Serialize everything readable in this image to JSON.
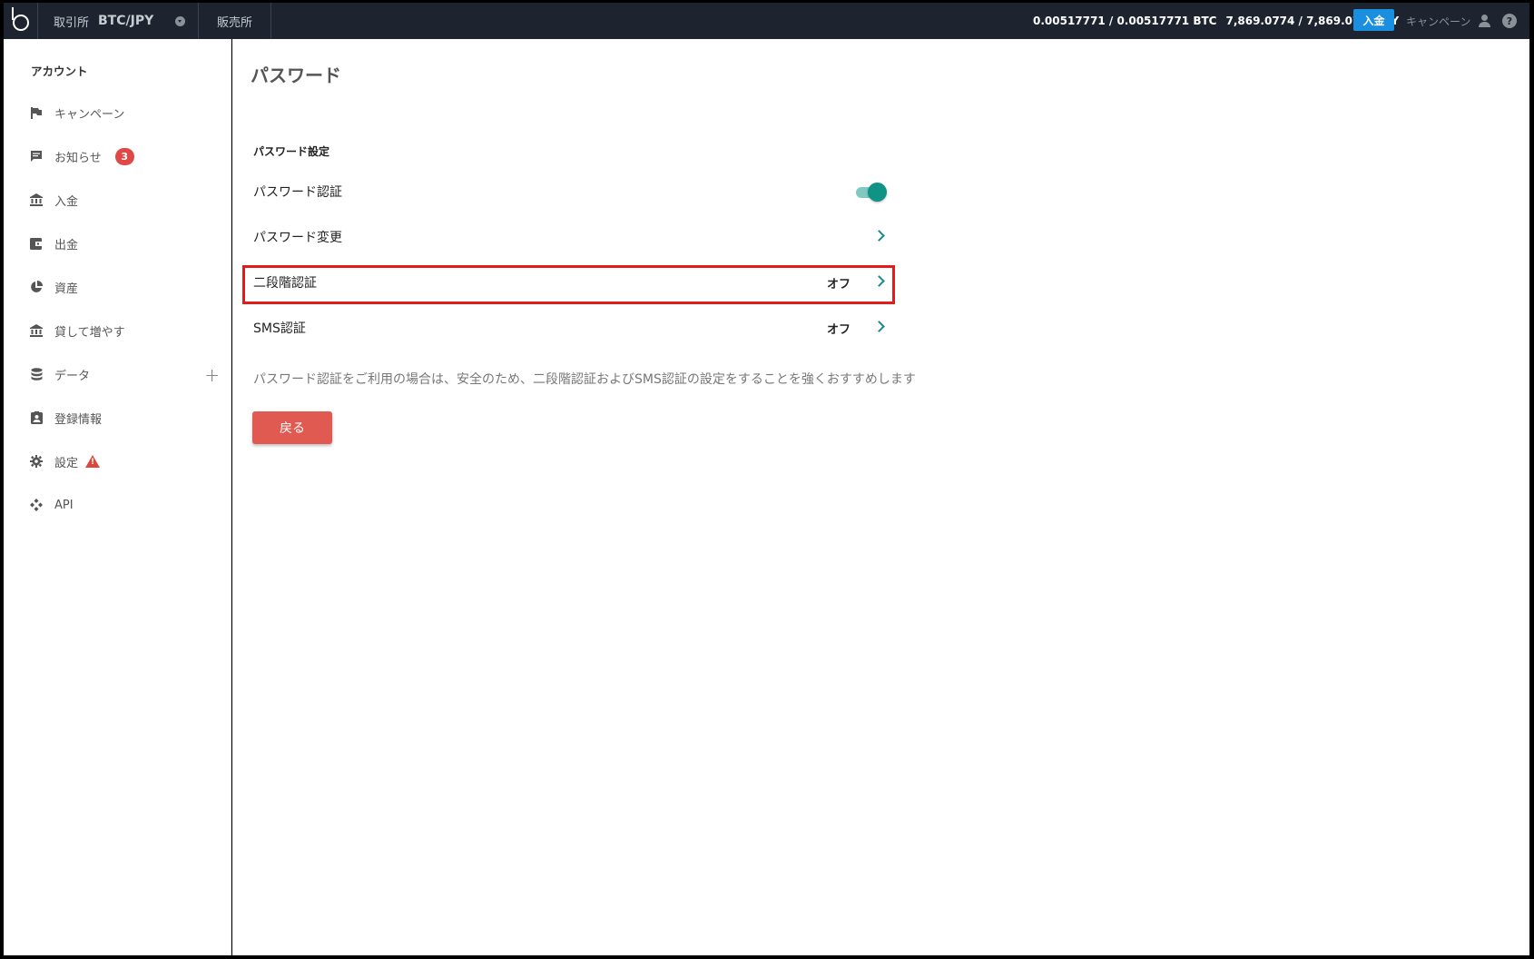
{
  "topbar": {
    "market_label": "取引所",
    "pair": "BTC/JPY",
    "shop_label": "販売所",
    "balance_btc": "0.00517771 / 0.00517771 BTC",
    "balance_jpy": "7,869.0774 / 7,869.0774 JPY",
    "deposit_label": "入金",
    "campaign_label": "キャンペーン",
    "help_glyph": "?"
  },
  "sidebar": {
    "heading": "アカウント",
    "items": [
      {
        "label": "キャンペーン",
        "icon": "flag-icon"
      },
      {
        "label": "お知らせ",
        "icon": "message-icon",
        "badge": "3"
      },
      {
        "label": "入金",
        "icon": "bank-icon"
      },
      {
        "label": "出金",
        "icon": "wallet-icon"
      },
      {
        "label": "資産",
        "icon": "pie-chart-icon"
      },
      {
        "label": "貸して増やす",
        "icon": "bank-icon"
      },
      {
        "label": "データ",
        "icon": "database-icon"
      },
      {
        "label": "登録情報",
        "icon": "id-card-icon"
      },
      {
        "label": "設定",
        "icon": "gear-icon",
        "warning": "!"
      },
      {
        "label": "API",
        "icon": "api-icon"
      }
    ]
  },
  "main": {
    "title": "パスワード",
    "section_title": "パスワード設定",
    "rows": [
      {
        "label": "パスワード認証",
        "toggle_on": true
      },
      {
        "label": "パスワード変更"
      },
      {
        "label": "二段階認証",
        "value": "オフ"
      },
      {
        "label": "SMS認証",
        "value": "オフ"
      }
    ],
    "note": "パスワード認証をご利用の場合は、安全のため、二段階認証およびSMS認証の設定をすることを強くおすすめします",
    "back_label": "戻る"
  },
  "colors": {
    "topbar_bg": "#1d2430",
    "accent_teal": "#0f9384",
    "deposit_blue": "#1a8fe0",
    "back_red": "#e05a52",
    "highlight_red": "#e31b1b"
  }
}
